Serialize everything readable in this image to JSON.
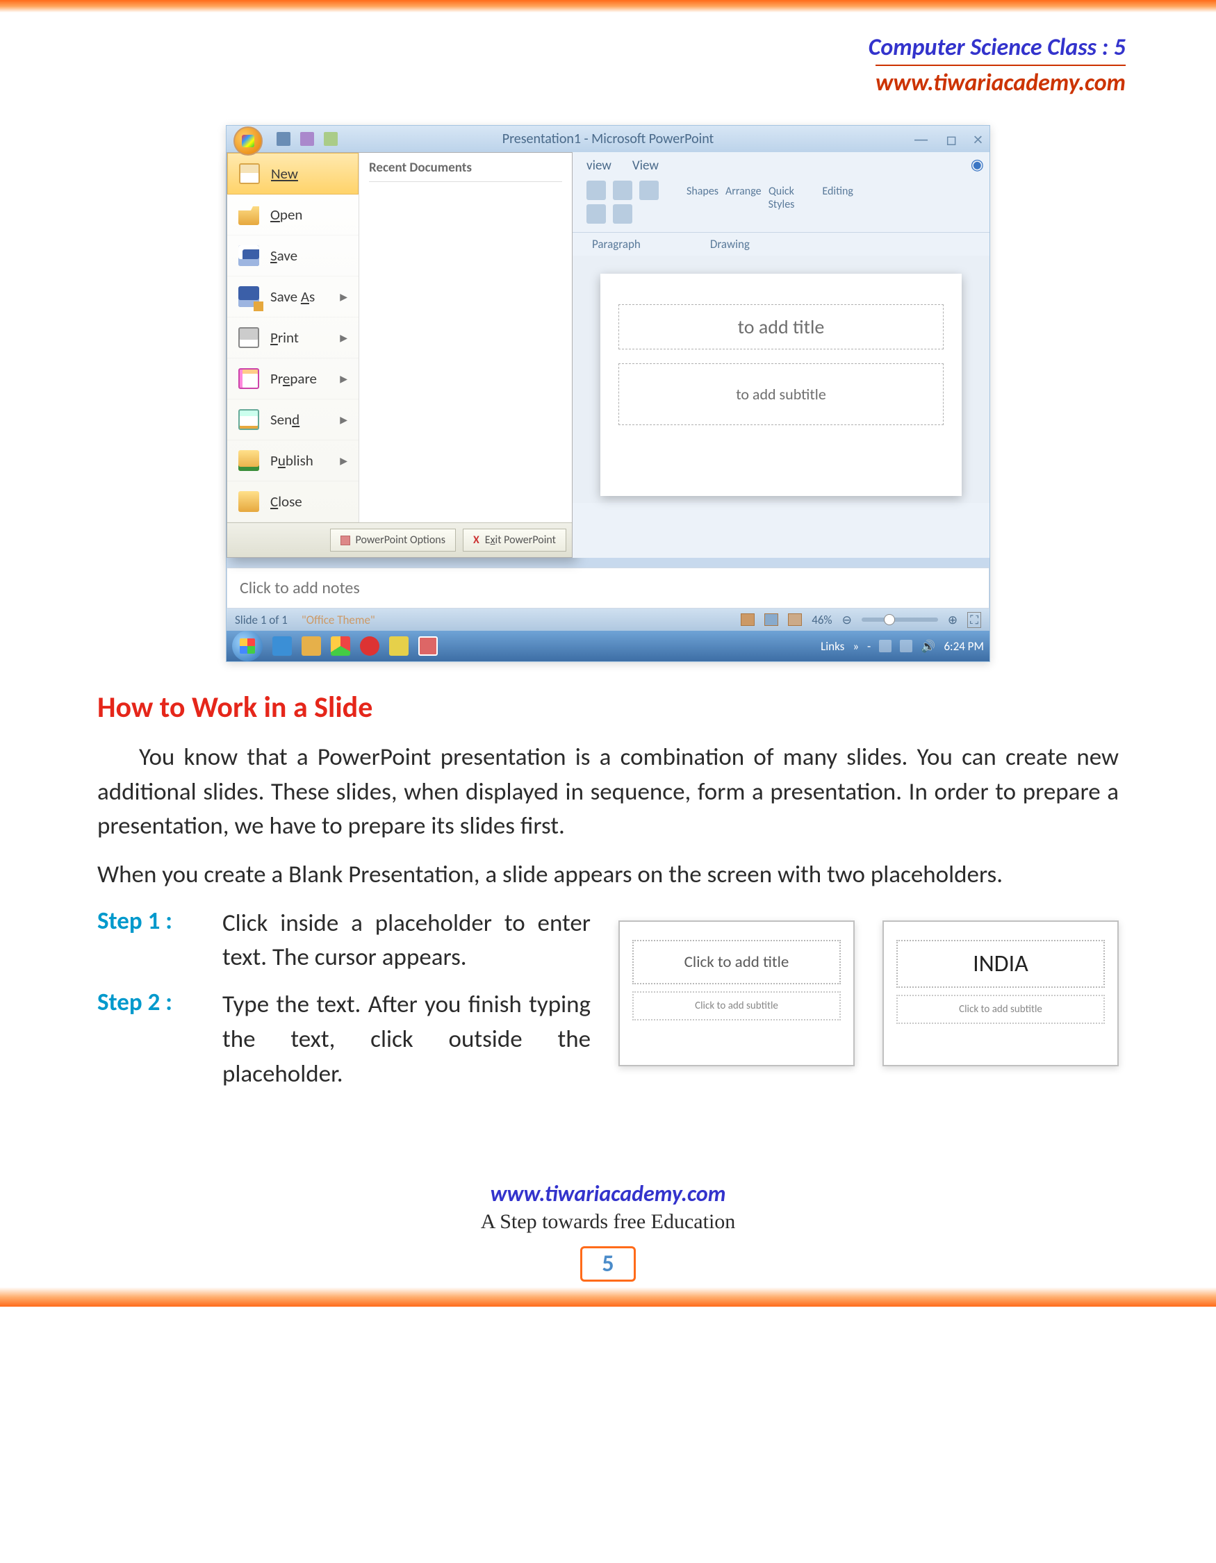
{
  "header": {
    "line1": "Computer Science Class : 5",
    "line2": "www.tiwariacademy.com"
  },
  "powerpoint": {
    "title": "Presentation1 - Microsoft PowerPoint",
    "window_buttons": {
      "min": "—",
      "max": "□",
      "close": "×"
    },
    "tabs": {
      "view1": "view",
      "view2": "View"
    },
    "ribbon": {
      "shapes": "Shapes",
      "arrange": "Arrange",
      "quick": "Quick",
      "styles": "Styles",
      "editing": "Editing",
      "paragraph": "Paragraph",
      "drawing": "Drawing"
    },
    "office_menu": {
      "recent": "Recent Documents",
      "items": {
        "new": "New",
        "open": "Open",
        "save": "Save",
        "saveas": "Save As",
        "print": "Print",
        "prepare": "Prepare",
        "send": "Send",
        "publish": "Publish",
        "close": "Close"
      },
      "footer": {
        "options": "PowerPoint Options",
        "exit": "Exit PowerPoint"
      }
    },
    "slide": {
      "title_ph": "to add title",
      "sub_ph": "to add subtitle"
    },
    "notes": "Click to add notes",
    "status": {
      "slide": "Slide 1 of 1",
      "theme": "\"Office Theme\"",
      "zoom": "46%"
    },
    "taskbar": {
      "links": "Links",
      "time": "6:24 PM"
    }
  },
  "doc": {
    "heading": "How to Work in a Slide",
    "p1": "You know that a PowerPoint presentation is a combination of many slides. You can create new additional slides. These slides, when displayed in sequence, form a presentation. In order to prepare a presentation, we have to prepare its slides first.",
    "p2": "When you create a Blank Presentation, a slide appears on the screen with two placeholders.",
    "steps": [
      {
        "label": "Step 1  :",
        "text": "Click inside a placeholder to enter text. The cursor appears."
      },
      {
        "label": "Step 2  :",
        "text": "Type the text. After you finish typing the text, click outside the placeholder."
      }
    ],
    "mini": {
      "title_ph": "Click to add title",
      "sub_ph": "Click to add subtitle",
      "india": "INDIA"
    }
  },
  "footer": {
    "url": "www.tiwariacademy.com",
    "tag": "A Step towards free Education",
    "page": "5"
  }
}
